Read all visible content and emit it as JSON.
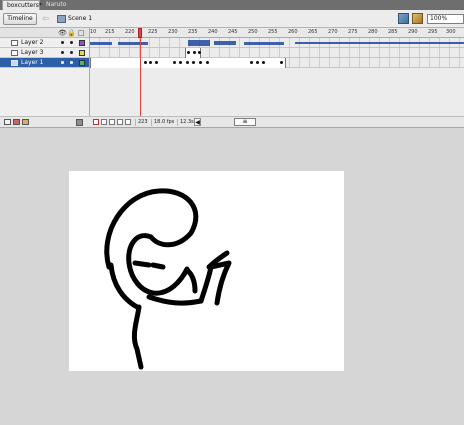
{
  "document_tabs": {
    "active": "boxcutters*",
    "inactive": "Naruto chick"
  },
  "toolbar": {
    "timeline_button": "Timeline",
    "back_arrow": "⇦",
    "scene_label": "Scene 1",
    "zoom_value": "100%"
  },
  "layers_header": {
    "eye_icon": "👁",
    "lock_icon": "🔒",
    "outline_icon": "□"
  },
  "layers": [
    {
      "name": "Layer 2",
      "swatch": "#8a58b3",
      "icon": "layer-icon"
    },
    {
      "name": "Layer 3",
      "swatch": "#e7d84f",
      "icon": "layer-icon"
    },
    {
      "name": "Layer 1",
      "swatch": "#58b56a",
      "icon": "layer-icon",
      "selected": true
    }
  ],
  "ruler": {
    "ticks": [
      "10",
      "215",
      "220",
      "225",
      "230",
      "235",
      "240",
      "245",
      "250",
      "255",
      "260",
      "265",
      "270",
      "275",
      "280",
      "285",
      "290",
      "295",
      "300"
    ]
  },
  "footer": {
    "frame": "223",
    "fps": "18.0 fps",
    "time": "12.3s",
    "scroll_left": "◀",
    "scroll_right": "▶",
    "thumb": "≡"
  },
  "colors": {
    "selected_layer": "#2d5ea8",
    "playhead": "#e24343",
    "audio_wave": "#1f46a1"
  }
}
